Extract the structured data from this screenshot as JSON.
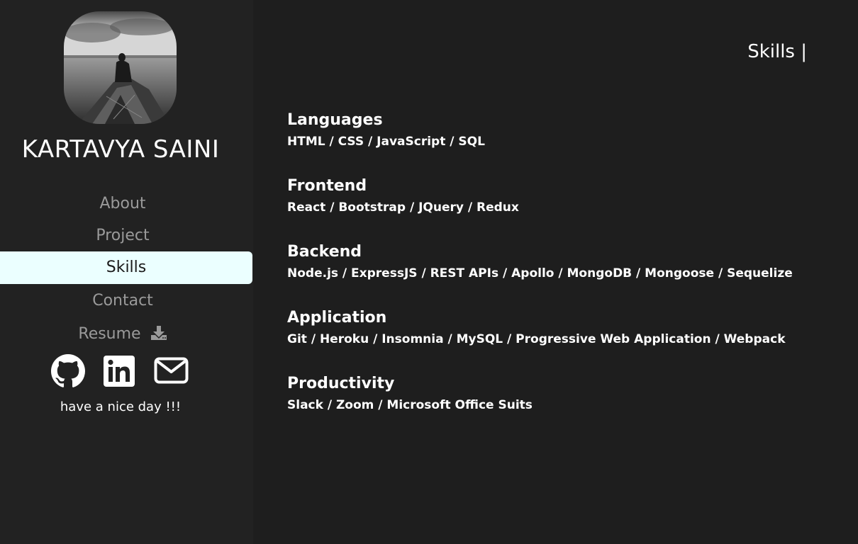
{
  "profile": {
    "name": "KARTAVYA SAINI",
    "avatar_alt": "person sitting in a boat on a lake"
  },
  "nav": {
    "items": [
      {
        "label": "About"
      },
      {
        "label": "Project"
      },
      {
        "label": "Skills"
      },
      {
        "label": "Contact"
      },
      {
        "label": "Resume"
      }
    ],
    "active": "Skills",
    "resume_icon": "download-icon"
  },
  "socials": [
    {
      "icon": "github-icon"
    },
    {
      "icon": "linkedin-icon"
    },
    {
      "icon": "envelope-icon"
    }
  ],
  "farewell": "have a nice day !!!",
  "page": {
    "heading": "Skills |"
  },
  "skills": [
    {
      "title": "Languages",
      "list": "HTML / CSS / JavaScript / SQL"
    },
    {
      "title": "Frontend",
      "list": "React / Bootstrap / JQuery / Redux"
    },
    {
      "title": "Backend",
      "list": "Node.js / ExpressJS / REST APIs / Apollo / MongoDB / Mongoose / Sequelize"
    },
    {
      "title": "Application",
      "list": "Git / Heroku / Insomnia / MySQL / Progressive Web Application / Webpack"
    },
    {
      "title": "Productivity",
      "list": "Slack / Zoom / Microsoft Office Suits"
    }
  ],
  "colors": {
    "background": "#1e1e1e",
    "sidebar": "#222222",
    "active_nav": "#ebffff",
    "muted_text": "#9a9a9a",
    "text": "#ffffff"
  }
}
